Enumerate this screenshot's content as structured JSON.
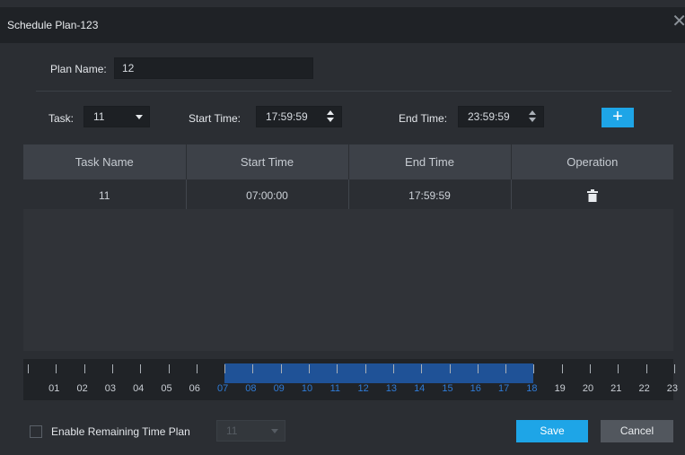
{
  "dialog": {
    "title": "Schedule Plan-123"
  },
  "plan": {
    "label": "Plan Name:",
    "value": "12"
  },
  "task_row": {
    "task_label": "Task:",
    "task_value": "11",
    "start_label": "Start Time:",
    "start_value": "17:59:59",
    "end_label": "End Time:",
    "end_value": "23:59:59",
    "add_label": "+"
  },
  "table": {
    "columns": [
      "Task Name",
      "Start Time",
      "End Time",
      "Operation"
    ],
    "rows": [
      {
        "task": "11",
        "start": "07:00:00",
        "end": "17:59:59",
        "operation": "trash-icon"
      }
    ]
  },
  "timeline": {
    "hours": [
      "01",
      "02",
      "03",
      "04",
      "05",
      "06",
      "07",
      "08",
      "09",
      "10",
      "11",
      "12",
      "13",
      "14",
      "15",
      "16",
      "17",
      "18",
      "19",
      "20",
      "21",
      "22",
      "23"
    ],
    "selected_range": [
      "07:00:00",
      "17:59:59"
    ]
  },
  "footer": {
    "remaining_label": "Enable Remaining Time Plan",
    "remaining_value": "11",
    "save_label": "Save",
    "cancel_label": "Cancel"
  },
  "colors": {
    "accent": "#1ea5e7",
    "timeline_selection": "#1f5297",
    "background": "#2b2e33"
  }
}
